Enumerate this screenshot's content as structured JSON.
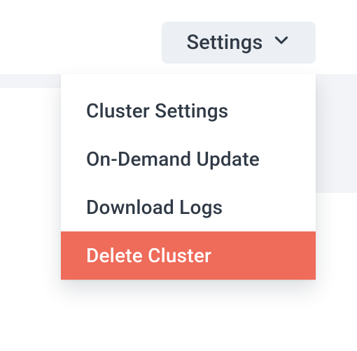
{
  "settings_button": {
    "label": "Settings"
  },
  "menu": {
    "items": [
      {
        "label": "Cluster Settings",
        "hovered": false
      },
      {
        "label": "On-Demand Update",
        "hovered": false
      },
      {
        "label": "Download Logs",
        "hovered": false
      },
      {
        "label": "Delete Cluster",
        "hovered": true
      }
    ]
  },
  "colors": {
    "button_bg": "#eceff3",
    "text": "#303a46",
    "hover_bg": "#ef6b5a",
    "hover_fg": "#ffffff",
    "band_bg": "#f3f4f7"
  }
}
